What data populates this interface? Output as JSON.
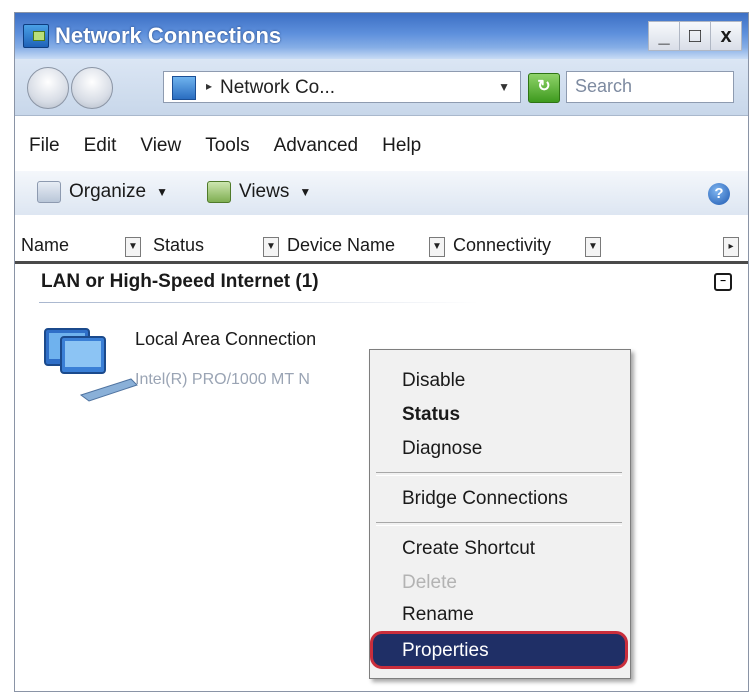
{
  "window": {
    "title": "Network Connections",
    "caption_buttons": [
      "_",
      "□",
      "x"
    ]
  },
  "address_bar": {
    "path": "Network Co...",
    "search_placeholder": "Search"
  },
  "menubar": {
    "items": [
      "File",
      "Edit",
      "View",
      "Tools",
      "Advanced",
      "Help"
    ]
  },
  "toolbar": {
    "organize_label": "Organize",
    "views_label": "Views"
  },
  "columns": [
    "Name",
    "Status",
    "Device Name",
    "Connectivity"
  ],
  "group": {
    "header": "LAN or High-Speed Internet (1)"
  },
  "connection": {
    "name": "Local Area Connection",
    "device": "Intel(R) PRO/1000 MT N"
  },
  "context_menu": {
    "items": [
      {
        "label": "Disable",
        "style": "normal"
      },
      {
        "label": "Status",
        "style": "bold"
      },
      {
        "label": "Diagnose",
        "style": "normal"
      },
      {
        "label": "Bridge Connections",
        "style": "normal"
      },
      {
        "label": "Create Shortcut",
        "style": "normal"
      },
      {
        "label": "Delete",
        "style": "disabled"
      },
      {
        "label": "Rename",
        "style": "normal"
      },
      {
        "label": "Properties",
        "style": "selected"
      }
    ]
  },
  "colors": {
    "highlight_fill": "#1f2f66",
    "highlight_border": "#c92e3c",
    "title_blue": "#3c6fc4"
  }
}
